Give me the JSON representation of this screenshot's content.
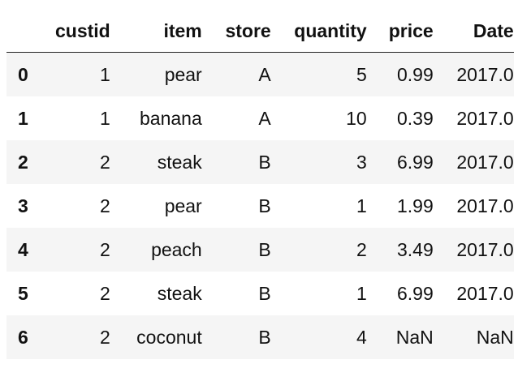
{
  "table": {
    "columns": [
      "custid",
      "item",
      "store",
      "quantity",
      "price",
      "Date"
    ],
    "rows": [
      {
        "index": "0",
        "custid": "1",
        "item": "pear",
        "store": "A",
        "quantity": "5",
        "price": "0.99",
        "date": "2017.0"
      },
      {
        "index": "1",
        "custid": "1",
        "item": "banana",
        "store": "A",
        "quantity": "10",
        "price": "0.39",
        "date": "2017.0"
      },
      {
        "index": "2",
        "custid": "2",
        "item": "steak",
        "store": "B",
        "quantity": "3",
        "price": "6.99",
        "date": "2017.0"
      },
      {
        "index": "3",
        "custid": "2",
        "item": "pear",
        "store": "B",
        "quantity": "1",
        "price": "1.99",
        "date": "2017.0"
      },
      {
        "index": "4",
        "custid": "2",
        "item": "peach",
        "store": "B",
        "quantity": "2",
        "price": "3.49",
        "date": "2017.0"
      },
      {
        "index": "5",
        "custid": "2",
        "item": "steak",
        "store": "B",
        "quantity": "1",
        "price": "6.99",
        "date": "2017.0"
      },
      {
        "index": "6",
        "custid": "2",
        "item": "coconut",
        "store": "B",
        "quantity": "4",
        "price": "NaN",
        "date": "NaN"
      }
    ]
  }
}
